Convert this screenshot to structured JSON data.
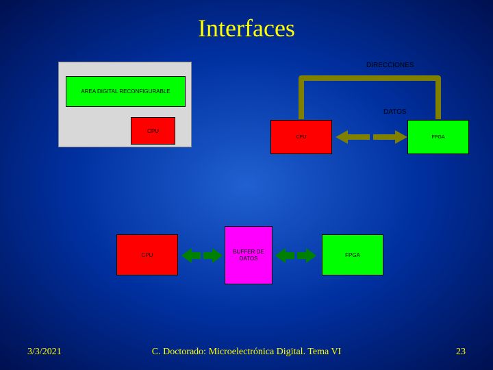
{
  "title": "Interfaces",
  "footer": {
    "date": "3/3/2021",
    "center": "C. Doctorado: Microelectrónica Digital.  Tema VI",
    "page": "23"
  },
  "panel1": {
    "green_label": "AREA DIGITAL RECONFIGURABLE",
    "cpu_label": "CPU"
  },
  "panel2": {
    "direcciones": "DIRECCIONES",
    "datos": "DATOS",
    "cpu": "CPU",
    "fpga": "FPGA"
  },
  "panel3": {
    "cpu": "CPU",
    "buffer": "BUFFER\nDE\nDATOS",
    "fpga": "FPGA"
  },
  "colors": {
    "cpu": "#ff0000",
    "fpga": "#00ff00",
    "buffer": "#ff00ff",
    "arrow_olive": "#808000",
    "arrow_green": "#008000"
  }
}
